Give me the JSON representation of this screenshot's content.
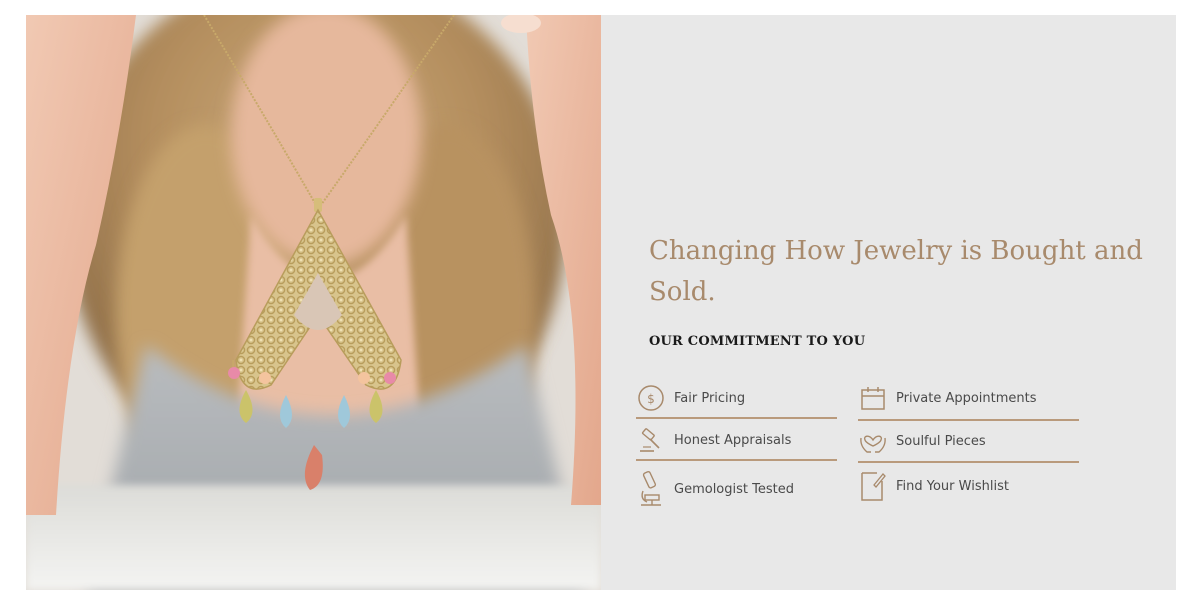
{
  "hero": {
    "headline": "Changing How Jewelry is Bought and Sold.",
    "subhead": "OUR COMMITMENT TO YOU"
  },
  "features": {
    "left": [
      {
        "label": "Fair Pricing",
        "icon": "dollar-coin-icon"
      },
      {
        "label": "Honest Appraisals",
        "icon": "gavel-icon"
      },
      {
        "label": "Gemologist Tested",
        "icon": "microscope-icon"
      }
    ],
    "right": [
      {
        "label": "Private Appointments",
        "icon": "calendar-icon"
      },
      {
        "label": "Soulful Pieces",
        "icon": "heart-hands-icon"
      },
      {
        "label": "Find Your Wishlist",
        "icon": "wishlist-note-icon"
      }
    ]
  },
  "colors": {
    "accent": "#a88a6c",
    "panel_background": "#e8e8e8",
    "rule": "#b99a7c"
  }
}
